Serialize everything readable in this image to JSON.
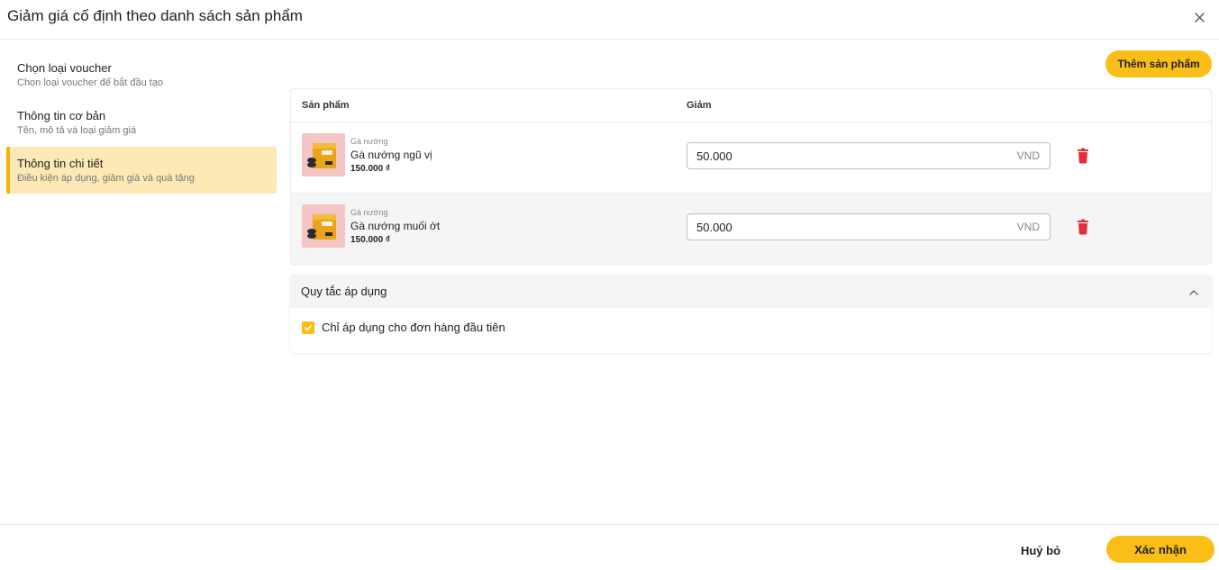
{
  "dialog": {
    "title": "Giảm giá cố định theo danh sách sản phẩm"
  },
  "steps": [
    {
      "title": "Chọn loại voucher",
      "desc": "Chọn loại voucher để bắt đầu tạo"
    },
    {
      "title": "Thông tin cơ bản",
      "desc": "Tên, mô tả và loại giảm giá"
    },
    {
      "title": "Thông tin chi tiết",
      "desc": "Điều kiện áp dụng, giảm giá và quà tặng"
    }
  ],
  "active_step": 3,
  "toolbar": {
    "add_product_label": "Thêm sản phẩm"
  },
  "table": {
    "columns": [
      "Sản phẩm",
      "Giảm"
    ],
    "rows": [
      {
        "category": "Gà nướng",
        "name": "Gà nướng ngũ vị",
        "price": "150.000 ₫",
        "discount": "50.000",
        "unit": "VND"
      },
      {
        "category": "Gà nướng",
        "name": "Gà nướng muối ớt",
        "price": "150.000 ₫",
        "discount": "50.000",
        "unit": "VND"
      }
    ]
  },
  "rules": {
    "title": "Quy tắc áp dụng",
    "expanded": true,
    "items": [
      {
        "label": "Chỉ áp dụng cho đơn hàng đầu tiên",
        "checked": true
      }
    ]
  },
  "footer": {
    "cancel_label": "Huỷ bỏ",
    "confirm_label": "Xác nhận"
  },
  "colors": {
    "accent": "#fbbe16",
    "active_step_bg": "#fde9b6",
    "delete": "#e0303d"
  },
  "icons": {
    "close": "close-icon",
    "delete": "trash-icon",
    "collapse": "chevron-up-icon",
    "check": "check-icon"
  }
}
